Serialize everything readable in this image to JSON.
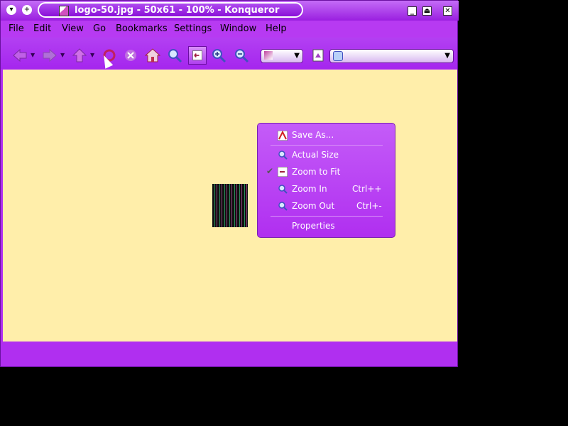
{
  "window": {
    "title": "logo-50.jpg - 50x61 - 100% - Konqueror",
    "left_buttons": [
      "▾",
      "+"
    ],
    "right_buttons": [
      "_",
      "⏏",
      "✕"
    ]
  },
  "menubar": {
    "items": [
      {
        "label": "File"
      },
      {
        "label": "Edit"
      },
      {
        "label": "View"
      },
      {
        "label": "Go"
      },
      {
        "label": "Bookmarks"
      },
      {
        "label": "Settings"
      },
      {
        "label": "Window"
      },
      {
        "label": "Help"
      }
    ]
  },
  "toolbar": {
    "icons": [
      "back-icon",
      "forward-icon",
      "up-icon",
      "reload-icon",
      "stop-icon",
      "home-icon",
      "zoom-icon",
      "zoom-to-fit-icon",
      "zoom-in-icon",
      "zoom-out-icon"
    ]
  },
  "context_menu": {
    "items": [
      {
        "label": "Save As...",
        "shortcut": ""
      },
      {
        "label": "Actual Size",
        "shortcut": ""
      },
      {
        "label": "Zoom to Fit",
        "shortcut": "",
        "checked": true
      },
      {
        "label": "Zoom In",
        "shortcut": "Ctrl++"
      },
      {
        "label": "Zoom Out",
        "shortcut": "Ctrl+-"
      },
      {
        "label": "Properties",
        "shortcut": ""
      }
    ]
  },
  "colors": {
    "accent": "#b02ff0",
    "content_bg": "#ffeeaa"
  }
}
